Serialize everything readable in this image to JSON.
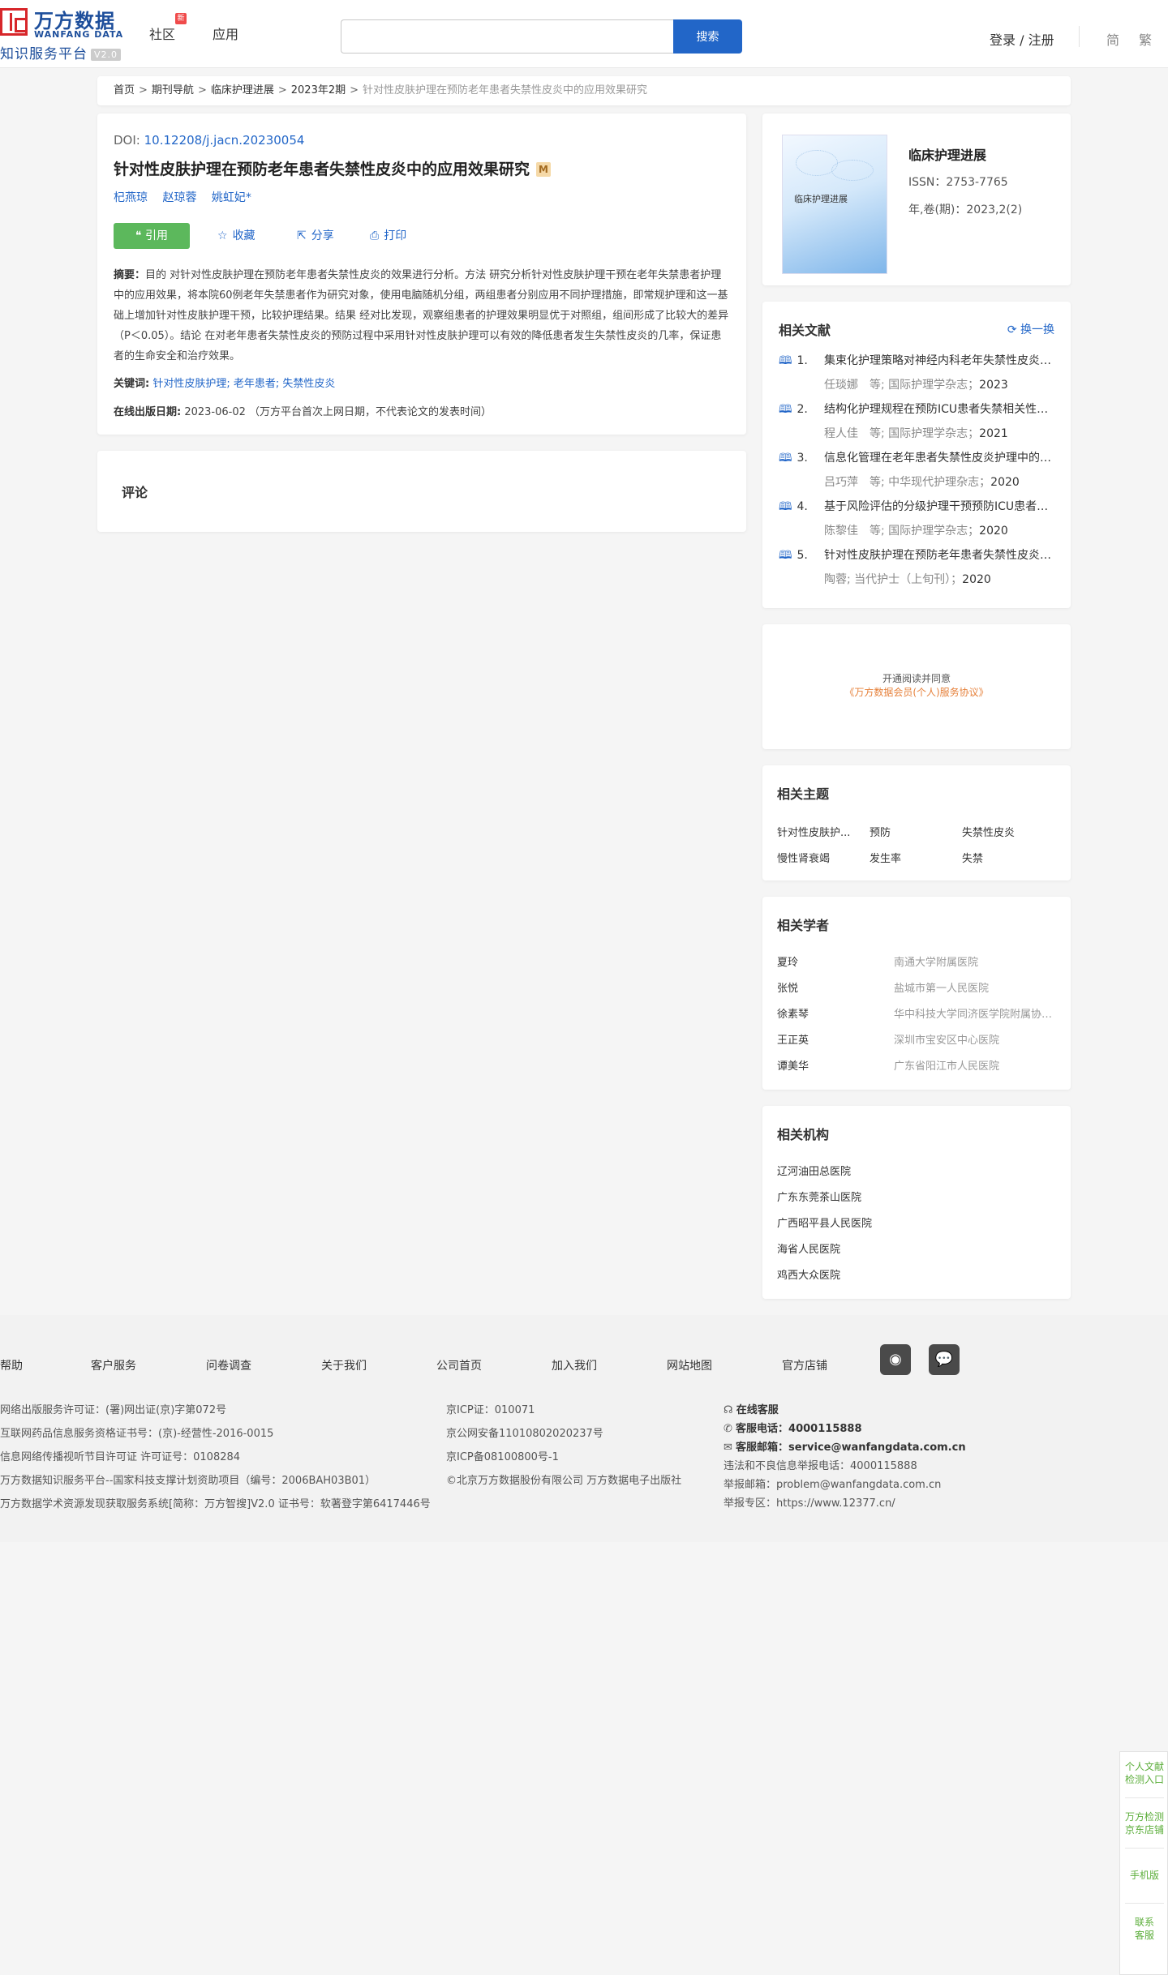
{
  "header": {
    "logo_cn": "万方数据",
    "logo_en": "WANFANG DATA",
    "logo_sub": "知识服务平台",
    "logo_version": "V2.0",
    "nav": [
      {
        "label": "社区"
      },
      {
        "label": "应用"
      }
    ],
    "nav_badge": "新",
    "search_placeholder": "",
    "search_button": "搜索",
    "login": "登录 / 注册",
    "lang_simplified": "简",
    "lang_traditional": "繁"
  },
  "breadcrumb": {
    "items": [
      "首页",
      "期刊导航",
      "临床护理进展",
      "2023年2期"
    ],
    "current": "针对性皮肤护理在预防老年患者失禁性皮炎中的应用效果研究"
  },
  "article": {
    "doi_label": "DOI:",
    "doi": "10.12208/j.jacn.20230054",
    "title": "针对性皮肤护理在预防老年患者失禁性皮炎中的应用效果研究",
    "title_badge": "M",
    "authors": [
      "杞燕琼",
      "赵琼蓉",
      "姚虹妃*"
    ],
    "actions": {
      "cite": "引用",
      "favorite": "收藏",
      "share": "分享",
      "print": "打印"
    },
    "abstract_label": "摘要：",
    "abstract": "目的 对针对性皮肤护理在预防老年患者失禁性皮炎的效果进行分析。方法 研究分析针对性皮肤护理干预在老年失禁患者护理中的应用效果，将本院60例老年失禁患者作为研究对象，使用电脑随机分组，两组患者分别应用不同护理措施，即常规护理和这一基础上增加针对性皮肤护理干预，比较护理结果。结果 经对比发现，观察组患者的护理效果明显优于对照组，组间形成了比较大的差异（P＜0.05）。结论 在对老年患者失禁性皮炎的预防过程中采用针对性皮肤护理可以有效的降低患者发生失禁性皮炎的几率，保证患者的生命安全和治疗效果。",
    "keywords_label": "关键词:",
    "keywords": [
      "针对性皮肤护理;",
      "老年患者;",
      "失禁性皮炎"
    ],
    "pubdate_label": "在线出版日期:",
    "pubdate": "2023-06-02",
    "pubdate_note": "（万方平台首次上网日期，不代表论文的发表时间）"
  },
  "comment": {
    "title": "评论"
  },
  "journal": {
    "cover_title": "临床护理进展",
    "name": "临床护理进展",
    "issn": "ISSN：2753-7765",
    "volume": "年,卷(期)：2023,2(2)"
  },
  "related_docs": {
    "title": "相关文献",
    "refresh": "换一换",
    "items": [
      {
        "num": "1.",
        "title": "集束化护理策略对神经内科老年失禁性皮炎患者的影响",
        "authors": "任琰娜　等;",
        "journal": "国际护理学杂志；",
        "year": "2023"
      },
      {
        "num": "2.",
        "title": "结构化护理规程在预防ICU患者失禁相关性皮炎中的应用",
        "authors": "程人佳　等;",
        "journal": "国际护理学杂志；",
        "year": "2021"
      },
      {
        "num": "3.",
        "title": "信息化管理在老年患者失禁性皮炎护理中的应用效果",
        "authors": "吕巧萍　等;",
        "journal": "中华现代护理杂志；",
        "year": "2020"
      },
      {
        "num": "4.",
        "title": "基于风险评估的分级护理干预预防ICU患者失禁相关性皮炎",
        "authors": "陈黎佳　等;",
        "journal": "国际护理学杂志；",
        "year": "2020"
      },
      {
        "num": "5.",
        "title": "针对性皮肤护理在预防老年患者失禁性皮炎中的应用",
        "authors": "陶蓉;",
        "journal": "当代护士（上旬刊）；",
        "year": "2020"
      }
    ]
  },
  "vip": {
    "line1": "开通阅读并同意",
    "line2": "《万方数据会员(个人)服务协议》"
  },
  "topics": {
    "title": "相关主题",
    "items": [
      "针对性皮肤护...",
      "预防",
      "失禁性皮炎",
      "慢性肾衰竭",
      "发生率",
      "失禁"
    ]
  },
  "scholars": {
    "title": "相关学者",
    "items": [
      {
        "name": "夏玲",
        "org": "南通大学附属医院"
      },
      {
        "name": "张悦",
        "org": "盐城市第一人民医院"
      },
      {
        "name": "徐素琴",
        "org": "华中科技大学同济医学院附属协和医院"
      },
      {
        "name": "王正英",
        "org": "深圳市宝安区中心医院"
      },
      {
        "name": "谭美华",
        "org": "广东省阳江市人民医院"
      }
    ]
  },
  "orgs": {
    "title": "相关机构",
    "items": [
      "辽河油田总医院",
      "广东东莞茶山医院",
      "广西昭平县人民医院",
      "海省人民医院",
      "鸡西大众医院"
    ]
  },
  "footer": {
    "links": [
      "帮助",
      "客户服务",
      "问卷调查",
      "关于我们",
      "公司首页",
      "加入我们",
      "网站地图",
      "官方店铺"
    ],
    "col1": [
      "网络出版服务许可证：(署)网出证(京)字第072号",
      "互联网药品信息服务资格证书号：(京)-经营性-2016-0015",
      "信息网络传播视听节目许可证 许可证号：0108284",
      "万方数据知识服务平台--国家科技支撑计划资助项目（编号：2006BAH03B01）",
      "万方数据学术资源发现获取服务系统[简称：万方智搜]V2.0 证书号：软著登字第6417446号"
    ],
    "col2": [
      "京ICP证：010071",
      "京公网安备11010802020237号",
      "京ICP备08100800号-1",
      "©北京万方数据股份有限公司 万方数据电子出版社"
    ],
    "online_service": "在线客服",
    "phone_label": "客服电话：",
    "phone": "4000115888",
    "email_label": "客服邮箱：",
    "email": "service@wanfangdata.com.cn",
    "report_phone": "违法和不良信息举报电话：4000115888",
    "report_email": "举报邮箱：problem@wanfangdata.com.cn",
    "report_zone": "举报专区：https://www.12377.cn/"
  },
  "side": {
    "item1": [
      "个人文献",
      "检测入口"
    ],
    "item2": [
      "万方检测",
      "京东店铺"
    ],
    "item3": "手机版",
    "item4": [
      "联系",
      "客服"
    ]
  }
}
